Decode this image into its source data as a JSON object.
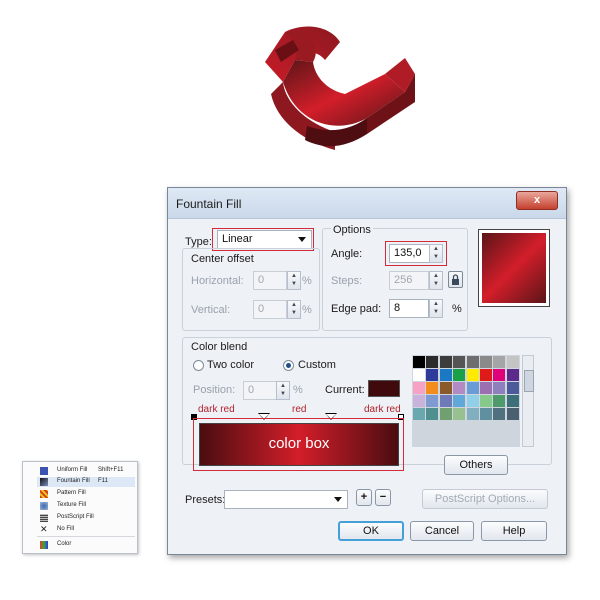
{
  "dialog": {
    "title": "Fountain Fill",
    "close_glyph": "x",
    "type_label": "Type:",
    "type_value": "Linear",
    "center_offset_label": "Center offset",
    "horizontal_label": "Horizontal:",
    "horizontal_value": "0",
    "vertical_label": "Vertical:",
    "vertical_value": "0",
    "percent": "%",
    "options_label": "Options",
    "angle_label": "Angle:",
    "angle_value": "135,0",
    "steps_label": "Steps:",
    "steps_value": "256",
    "edge_pad_label": "Edge pad:",
    "edge_pad_value": "8",
    "color_blend_label": "Color blend",
    "two_color_label": "Two color",
    "custom_label": "Custom",
    "position_label": "Position:",
    "position_value": "0",
    "current_label": "Current:",
    "stop_labels": [
      "dark red",
      "red",
      "dark red"
    ],
    "color_box_label": "color box",
    "others_label": "Others",
    "presets_label": "Presets:",
    "postscript_label": "PostScript Options...",
    "ok_label": "OK",
    "cancel_label": "Cancel",
    "help_label": "Help",
    "colors": {
      "dark_red": "#5a1518",
      "red": "#d31e2a",
      "current_swatch": "#3e0a0c",
      "highlight": "#d42a3a"
    },
    "palette_colors": [
      "#000000",
      "#2b2b2b",
      "#3c3c3c",
      "#555555",
      "#6e6e6e",
      "#8a8a8a",
      "#a5a5a5",
      "#c4c4c4",
      "#ffffff",
      "#2f3b9a",
      "#1a78c4",
      "#19a14a",
      "#ffeb00",
      "#e01a1a",
      "#e0007a",
      "#5b2a8a",
      "#f7a1c4",
      "#f28c1c",
      "#8b5a2b",
      "#b28bc4",
      "#6a9bd4",
      "#9c6fb0",
      "#8f7fbf",
      "#4a5a9a",
      "#c9b3dc",
      "#7f9ad1",
      "#6e7ab8",
      "#5fa8d8",
      "#8fd0e8",
      "#86c98a",
      "#4f9a6a",
      "#3c6f7a",
      "#6aa8b0",
      "#4f8f8f",
      "#70a070",
      "#99c090",
      "#80b0c0",
      "#6090a0",
      "#507080",
      "#4a6070"
    ]
  },
  "menu": {
    "items": [
      {
        "label": "Uniform Fill",
        "shortcut": "Shift+F11",
        "icon": "uniform-fill-icon"
      },
      {
        "label": "Fountain Fill",
        "shortcut": "F11",
        "icon": "fountain-fill-icon"
      },
      {
        "label": "Pattern Fill",
        "shortcut": "",
        "icon": "pattern-fill-icon"
      },
      {
        "label": "Texture Fill",
        "shortcut": "",
        "icon": "texture-fill-icon"
      },
      {
        "label": "PostScript Fill",
        "shortcut": "",
        "icon": "postscript-fill-icon"
      },
      {
        "label": "No Fill",
        "shortcut": "",
        "icon": "no-fill-icon"
      },
      {
        "label": "Color",
        "shortcut": "",
        "icon": "color-icon"
      }
    ]
  }
}
